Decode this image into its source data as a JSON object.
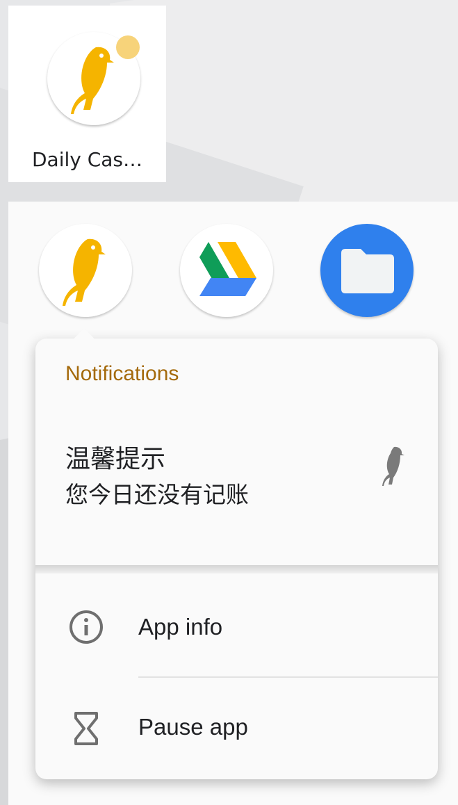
{
  "home_shortcut": {
    "app_label": "Daily Cas…",
    "icon": "parrot-icon",
    "badge": "notification-dot"
  },
  "dock_apps": [
    {
      "name": "Daily Cash",
      "icon": "parrot-icon"
    },
    {
      "name": "Drive",
      "icon": "google-drive-icon"
    },
    {
      "name": "Files",
      "icon": "folder-icon"
    }
  ],
  "popup": {
    "section_header": "Notifications",
    "notification": {
      "title": "温馨提示",
      "text": "您今日还没有记账",
      "icon": "parrot-icon"
    },
    "menu": [
      {
        "label": "App info",
        "icon": "info-icon"
      },
      {
        "label": "Pause app",
        "icon": "hourglass-icon"
      }
    ]
  },
  "colors": {
    "accent_header": "#a46a0c",
    "parrot": "#f5b400",
    "badge": "#f7d37a",
    "files_blue": "#2f80ed"
  }
}
